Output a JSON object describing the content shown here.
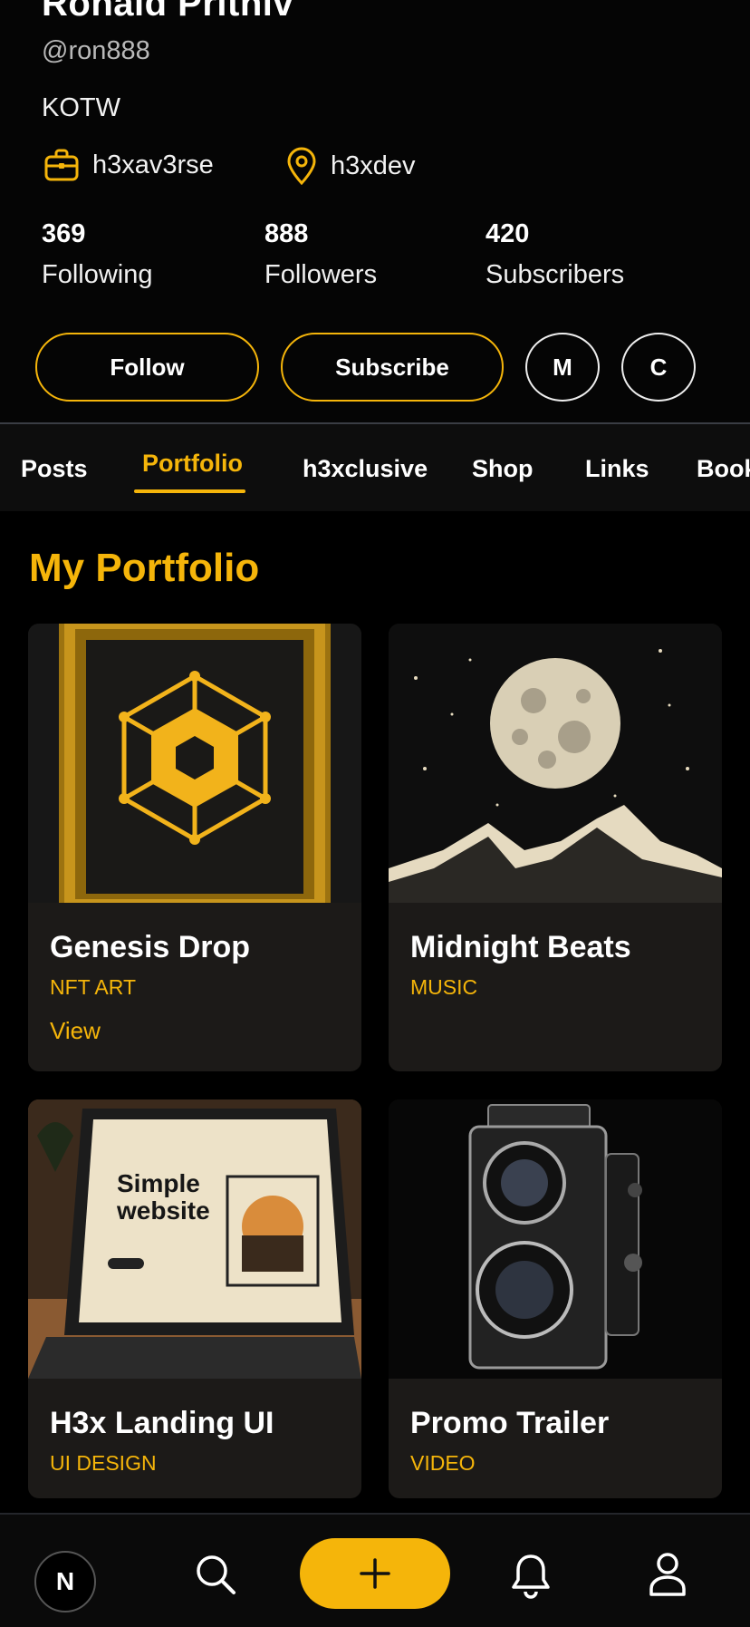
{
  "profile": {
    "name": "Ronald Prithiv",
    "handle": "@ron888",
    "bio": "KOTW",
    "work": "h3xav3rse",
    "location": "h3xdev",
    "stats": [
      {
        "value": "369",
        "label": "Following"
      },
      {
        "value": "888",
        "label": "Followers"
      },
      {
        "value": "420",
        "label": "Subscribers"
      }
    ],
    "actions": {
      "follow": "Follow",
      "subscribe": "Subscribe",
      "m": "M",
      "c": "C"
    }
  },
  "tabs": [
    "Posts",
    "Portfolio",
    "h3xclusive",
    "Shop",
    "Links",
    "Book"
  ],
  "active_tab": "Portfolio",
  "section_title": "My Portfolio",
  "portfolio": [
    {
      "title": "Genesis Drop",
      "category": "NFT ART",
      "action": "View"
    },
    {
      "title": "Midnight Beats",
      "category": "MUSIC"
    },
    {
      "title": "H3x Landing UI",
      "category": "UI DESIGN",
      "screen_text": "Simple website"
    },
    {
      "title": "Promo Trailer",
      "category": "VIDEO"
    }
  ],
  "bottom_nav": {
    "avatar_letter": "N",
    "icons": [
      "search-icon",
      "plus-icon",
      "bell-icon",
      "user-icon"
    ]
  },
  "colors": {
    "accent": "#f5b50a",
    "background": "#000000",
    "card": "#1c1a18"
  }
}
